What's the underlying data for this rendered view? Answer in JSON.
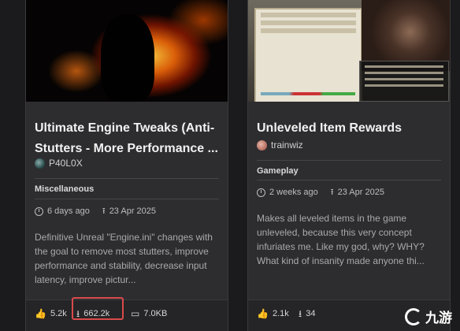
{
  "cards": [
    {
      "title": "Ultimate Engine Tweaks (Anti-Stutters - More Performance ...",
      "author": "P40L0X",
      "category": "Miscellaneous",
      "updated": "6 days ago",
      "published": "23 Apr 2025",
      "description": "Definitive Unreal \"Engine.ini\" changes with the goal to remove most stutters, improve performance and stability, decrease input latency, improve pictur...",
      "endorsements": "5.2k",
      "downloads": "662.2k",
      "size": "7.0KB"
    },
    {
      "title": "Unleveled Item Rewards",
      "author": "trainwiz",
      "category": "Gameplay",
      "updated": "2 weeks ago",
      "published": "23 Apr 2025",
      "description": "Makes all leveled items in the game unleveled, because this very concept infuriates me. Like my god, why? WHY? What kind of insanity made anyone thi...",
      "endorsements": "2.1k",
      "downloads": "34"
    }
  ],
  "watermark": {
    "text": "九游"
  },
  "icons": {
    "thumbs_up": "thumbs-up-icon",
    "download": "download-icon",
    "size": "hard-drive-icon",
    "clock": "clock-icon",
    "upload": "upload-icon"
  }
}
